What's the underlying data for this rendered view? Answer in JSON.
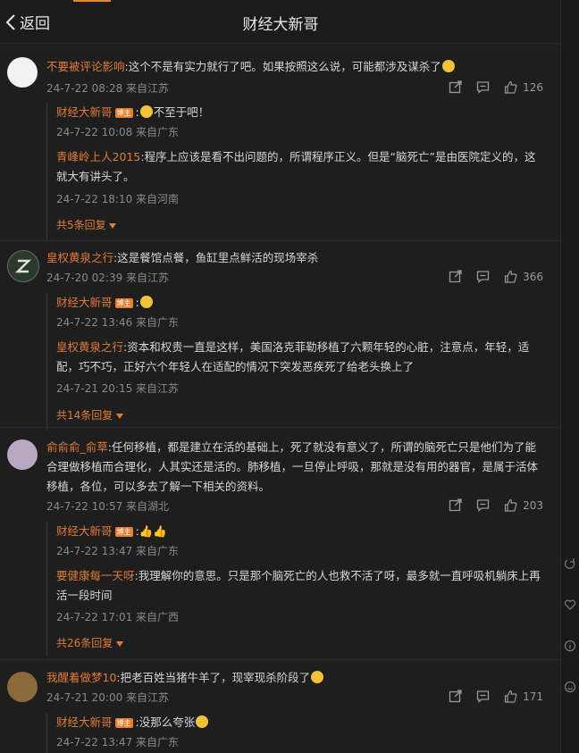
{
  "header": {
    "back_label": "返回",
    "title": "财经大新哥"
  },
  "badge_label": "博主",
  "comments": [
    {
      "user": "不要被评论影响",
      "text": ":这个不是有实力就行了吧。如果按照这么说，可能都涉及谋杀了",
      "meta": "24-7-22 08:28 来自江苏",
      "likes": "126",
      "replies": [
        {
          "user": "财经大新哥",
          "text": "不至于吧！",
          "meta": "24-7-22 10:08 来自广东"
        },
        {
          "user": "青峰岭上人2015",
          "text": ":程序上应该是看不出问题的，所谓程序正义。但是“脑死亡”是由医院定义的，这就大有讲头了。",
          "meta": "24-7-22 18:10 来自河南"
        }
      ],
      "more": "共5条回复"
    },
    {
      "user": "皇权黄泉之行",
      "text": ":这是餐馆点餐，鱼缸里点鲜活的现场宰杀",
      "meta": "24-7-20 02:39 来自江苏",
      "likes": "366",
      "replies": [
        {
          "user": "财经大新哥",
          "text": "",
          "meta": "24-7-22 13:46 来自广东"
        },
        {
          "user": "皇权黄泉之行",
          "text": ":资本和权贵一直是这样，美国洛克菲勒移植了六颗年轻的心脏，注意点，年轻，适配，巧不巧，正好六个年轻人在适配的情况下突发恶疾死了给老头换上了",
          "meta": "24-7-21 20:15 来自江苏"
        }
      ],
      "more": "共14条回复"
    },
    {
      "user": "俞俞俞_俞草",
      "text": ":任何移植，都是建立在活的基础上，死了就没有意义了，所谓的脑死亡只是他们为了能合理做移植而合理化，人其实还是活的。肺移植，一旦停止呼吸，那就是没有用的器官，是属于活体移植，各位，可以多去了解一下相关的资料。",
      "meta": "24-7-22 10:57 来自湖北",
      "likes": "203",
      "replies": [
        {
          "user": "财经大新哥",
          "text": "",
          "meta": "24-7-22 13:47 来自广东"
        },
        {
          "user": "要健康每一天呀",
          "text": ":我理解你的意思。只是那个脑死亡的人也救不活了呀，最多就一直呼吸机躺床上再活一段时间",
          "meta": "24-7-22 17:01 来自广西"
        }
      ],
      "more": "共26条回复"
    },
    {
      "user": "我醒着做梦10",
      "text": ":把老百姓当猪牛羊了，现宰现杀阶段了",
      "meta": "24-7-21 20:00 来自江苏",
      "likes": "171",
      "replies": [
        {
          "user": "财经大新哥",
          "text": ":没那么夸张",
          "meta": "24-7-22 13:47 来自广东"
        }
      ]
    }
  ],
  "colors": {
    "username": "#e07b39",
    "badge": "#e87d2a",
    "background": "#1e1e1e",
    "meta": "#8a8a8a"
  },
  "icons": [
    "back-chevron-icon",
    "share-icon",
    "comment-icon",
    "like-icon",
    "emoji-icon",
    "sidebar-share-icon",
    "sidebar-like-icon",
    "sidebar-info-icon",
    "sidebar-feedback-icon"
  ]
}
